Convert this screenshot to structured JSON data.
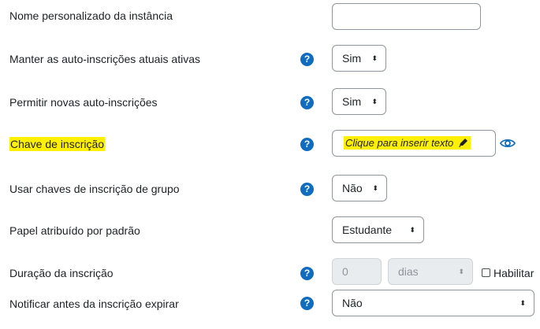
{
  "fields": {
    "instance_name": {
      "label": "Nome personalizado da instância",
      "value": ""
    },
    "keep_current": {
      "label": "Manter as auto-inscrições atuais ativas",
      "help": "?",
      "selected": "Sim"
    },
    "allow_new": {
      "label": "Permitir novas auto-inscrições",
      "help": "?",
      "selected": "Sim"
    },
    "enrol_key": {
      "label": "Chave de inscrição",
      "help": "?",
      "placeholder": "Clique para inserir texto"
    },
    "group_keys": {
      "label": "Usar chaves de inscrição de grupo",
      "help": "?",
      "selected": "Não"
    },
    "default_role": {
      "label": "Papel atribuído por padrão",
      "selected": "Estudante"
    },
    "duration": {
      "label": "Duração da inscrição",
      "help": "?",
      "number": "0",
      "unit": "dias",
      "enable_label": "Habilitar"
    },
    "notify": {
      "label": "Notificar antes da inscrição expirar",
      "help": "?",
      "selected": "Não"
    }
  },
  "icons": {
    "help": "question-circle-icon",
    "edit": "pencil-icon",
    "reveal": "eye-icon"
  },
  "colors": {
    "highlight": "#ffef00",
    "primary": "#0f6cbf"
  }
}
